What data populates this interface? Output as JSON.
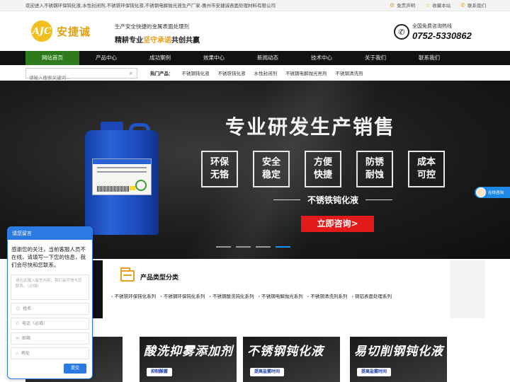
{
  "topbar": {
    "welcome": "欢迎进入不锈钢环保钝化液,水性封闭剂,不锈铁环保钝化液,不锈钢电解抛光液生产厂家-惠州市安捷诚表面处理材料有限公司",
    "links": [
      {
        "label": "免责声明",
        "icon": "disclaimer-icon"
      },
      {
        "label": "收藏本站",
        "icon": "star-icon"
      },
      {
        "label": "联系我们",
        "icon": "contact-icon"
      }
    ]
  },
  "header": {
    "logo_mark": "AJC",
    "logo_text": "安捷诚",
    "slogan_line1": "生产安全快捷的金属表面处理剂",
    "slogan_line2_a": "精耕专业",
    "slogan_line2_b": "坚守承诺",
    "slogan_line2_c": "共创共赢",
    "hotline_label": "全国免费咨询热线",
    "hotline_number": "0752-5330862"
  },
  "nav": {
    "items": [
      "网站首页",
      "产品中心",
      "成功案例",
      "效果中心",
      "新闻动态",
      "技术中心",
      "关于我们",
      "联系我们"
    ],
    "active_index": 0
  },
  "search": {
    "placeholder": "请输入搜索关键词...",
    "hot_label": "热门产品：",
    "hot_items": [
      "不锈钢钝化液",
      "不锈铁钝化液",
      "水性封闭剂",
      "不锈钢电解抛光亮剂",
      "不锈钢清洗剂"
    ]
  },
  "banner": {
    "headline": "专业研发生产销售",
    "features": [
      {
        "line1": "环保",
        "line2": "无铬"
      },
      {
        "line1": "安全",
        "line2": "稳定"
      },
      {
        "line1": "方便",
        "line2": "快捷"
      },
      {
        "line1": "防锈",
        "line2": "耐蚀"
      },
      {
        "line1": "成本",
        "line2": "可控"
      }
    ],
    "subtitle": "不锈铁钝化液",
    "cta": "立即咨询>",
    "slides": 4,
    "active_slide": 3
  },
  "service_float": {
    "label": "在线咨询"
  },
  "category": {
    "title": "产品类型分类",
    "links": [
      "不锈铁环保钝化系列",
      "不锈钢环保钝化系列",
      "不锈钢酸洗钝化系列",
      "不锈钢电解抛光系列",
      "不锈钢清洗剂系列",
      "铜铝表面处理系列"
    ]
  },
  "cards": [
    {
      "title": "闭剂",
      "tag": ""
    },
    {
      "title": "酸洗抑雾添加剂",
      "tag": "抑制酸雾"
    },
    {
      "title": "不锈钢钝化液",
      "tag": "提高盐雾时间"
    },
    {
      "title": "易切削钢钝化液",
      "tag": "提高盐雾时间"
    }
  ],
  "chat": {
    "title": "请您留言",
    "message": "感谢您的关注，当前客服人员不在线，请填写一下您的信息，我们会尽快和您联系。",
    "textarea_placeholder": "请在此输入留言内容，我们会尽快与您联系。（必填）",
    "fields": [
      {
        "label": "姓名",
        "icon": "user-icon"
      },
      {
        "label": "电话（必填）",
        "icon": "phone-icon"
      },
      {
        "label": "邮箱",
        "icon": "mail-icon"
      },
      {
        "label": "地址",
        "icon": "location-icon"
      }
    ],
    "submit": "提交"
  },
  "colors": {
    "accent": "#e8a020",
    "nav_active": "#2f7a1c",
    "cta_red": "#e21a1a",
    "chat_blue": "#2a7ae2"
  }
}
